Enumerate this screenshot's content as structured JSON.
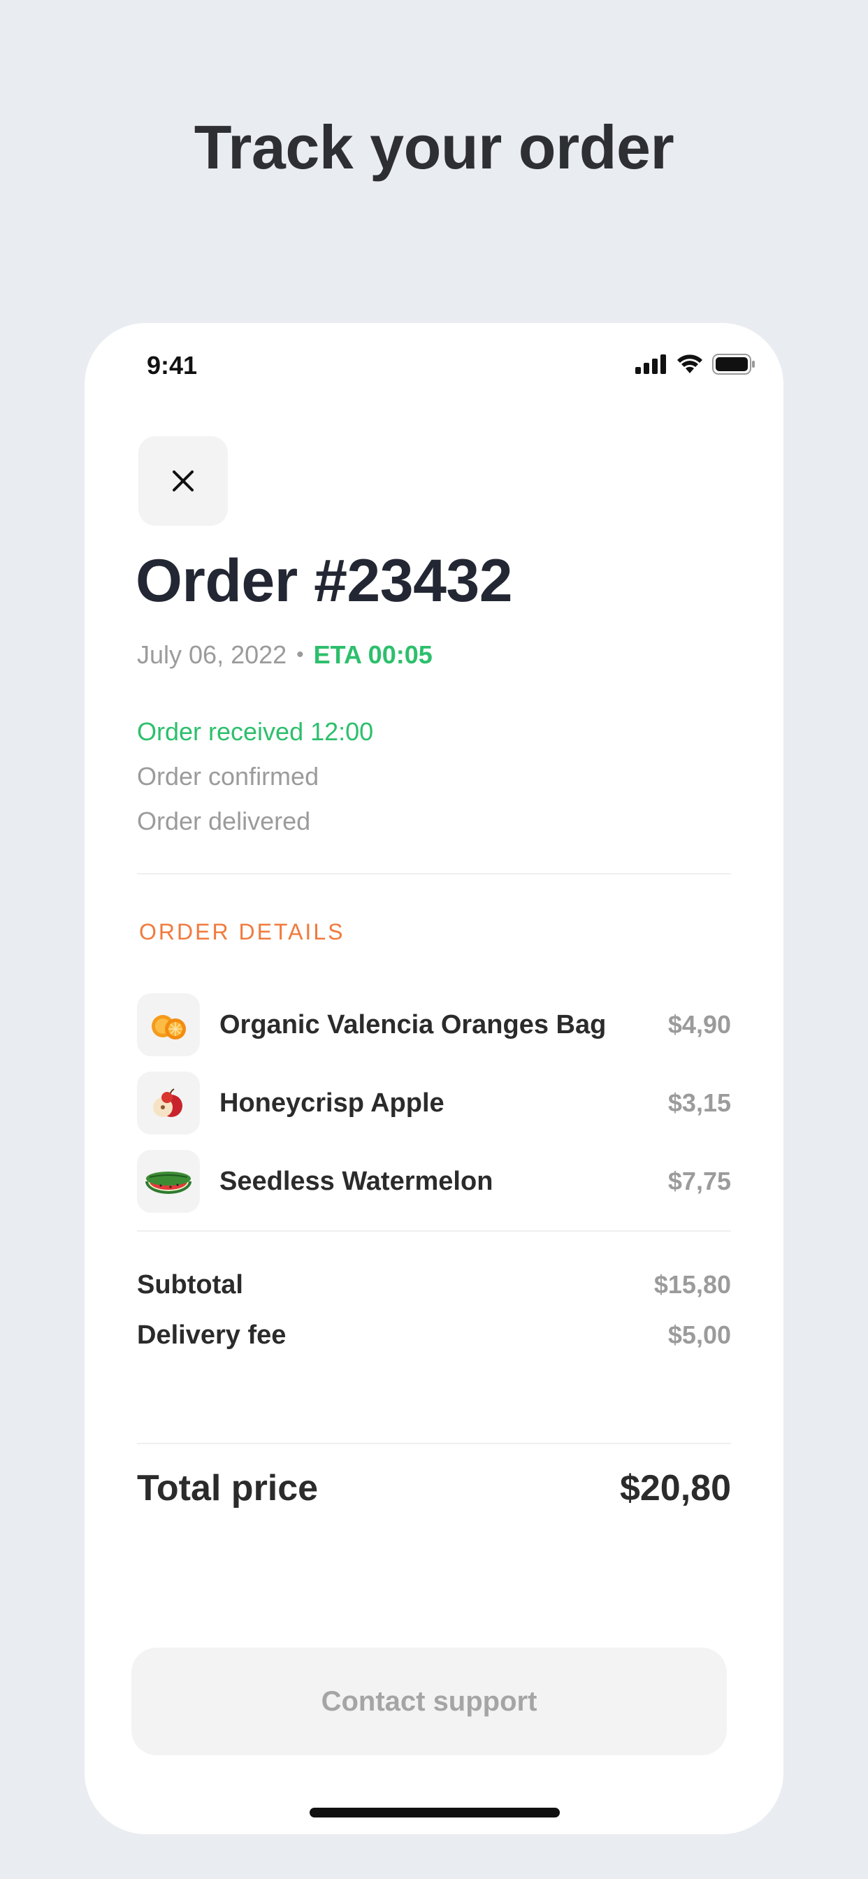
{
  "headline": "Track your order",
  "status_bar": {
    "time": "9:41",
    "icons": [
      "cellular-signal-icon",
      "wifi-icon",
      "battery-icon"
    ]
  },
  "close_icon": "close-icon",
  "order": {
    "title": "Order #23432",
    "date": "July 06, 2022",
    "separator": "•",
    "eta": "ETA 00:05"
  },
  "timeline": [
    {
      "label": "Order received 12:00",
      "active": true
    },
    {
      "label": "Order confirmed",
      "active": false
    },
    {
      "label": "Order delivered",
      "active": false
    }
  ],
  "order_details": {
    "title": "ORDER DETAILS",
    "items": [
      {
        "name": "Organic Valencia Oranges Bag",
        "price": "$4,90",
        "icon": "orange-icon"
      },
      {
        "name": "Honeycrisp Apple",
        "price": "$3,15",
        "icon": "apple-icon"
      },
      {
        "name": "Seedless Watermelon",
        "price": "$7,75",
        "icon": "watermelon-icon"
      }
    ]
  },
  "summary": {
    "subtotal_label": "Subtotal",
    "subtotal_value": "$15,80",
    "delivery_label": "Delivery fee",
    "delivery_value": "$5,00",
    "total_label": "Total price",
    "total_value": "$20,80"
  },
  "contact_button": "Contact support",
  "colors": {
    "accent_green": "#2dbf6c",
    "accent_orange": "#f07a3d",
    "background": "#e9ecf0"
  }
}
